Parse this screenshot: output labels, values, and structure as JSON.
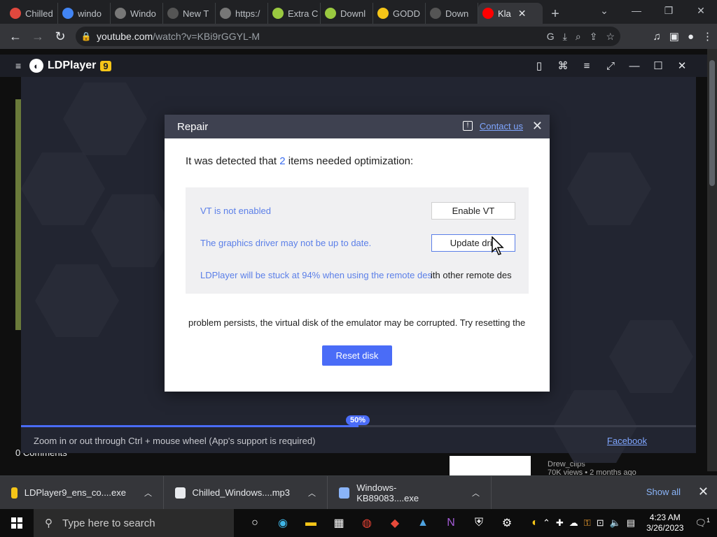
{
  "browser": {
    "tabs": [
      {
        "label": "Chilled",
        "icon": "chilled-icon",
        "color": "#e0483e"
      },
      {
        "label": "windo",
        "icon": "google-icon",
        "color": "#4285f4"
      },
      {
        "label": "Windo",
        "icon": "windows-tab-icon",
        "color": "#777"
      },
      {
        "label": "New T",
        "icon": "chrome-tab-icon",
        "color": "#555"
      },
      {
        "label": "https:/",
        "icon": "globe-icon",
        "color": "#777"
      },
      {
        "label": "Extra C",
        "icon": "android-icon",
        "color": "#9ac940"
      },
      {
        "label": "Downl",
        "icon": "android-icon",
        "color": "#9ac940"
      },
      {
        "label": "GODD",
        "icon": "ldplayer-icon",
        "color": "#f5c518"
      },
      {
        "label": "Down",
        "icon": "download-icon",
        "color": "#555"
      },
      {
        "label": "Kla",
        "icon": "youtube-icon",
        "color": "#ff0000"
      }
    ],
    "active_tab_close": "✕",
    "new_tab": "+",
    "url_host": "youtube.com",
    "url_path": "/watch?v=KBi9rGGYL-M"
  },
  "ldplayer": {
    "name": "LDPlayer",
    "version": "9",
    "progress_label": "50%",
    "progress_value": 0.5,
    "footer_hint": "Zoom in or out through Ctrl + mouse wheel (App's support is required)",
    "facebook": "Facebook"
  },
  "dialog": {
    "title": "Repair",
    "contact": "Contact us",
    "intro_prefix": "It was detected that ",
    "intro_count": "2",
    "intro_suffix": " items needed optimization:",
    "issues": [
      {
        "text": "VT is not enabled",
        "button": "Enable VT"
      },
      {
        "text": "The graphics driver may not be up to date.",
        "button": "Update driv"
      },
      {
        "text": "LDPlayer will be stuck at 94% when using the remote des",
        "tail": "ith other remote des"
      }
    ],
    "persist": "problem persists, the virtual disk of the emulator may be corrupted. Try resetting the",
    "reset": "Reset disk"
  },
  "youtube": {
    "comments": "0 Comments",
    "uploader": "Drew_clips",
    "meta": "70K views • 2 months ago"
  },
  "downloads": {
    "items": [
      {
        "name": "LDPlayer9_ens_co....exe",
        "icon": "ldplayer-icon",
        "color": "#f5c518"
      },
      {
        "name": "Chilled_Windows....mp3",
        "icon": "file-icon",
        "color": "#e8eaed"
      },
      {
        "name": "Windows-KB89083....exe",
        "icon": "installer-icon",
        "color": "#8ab4f8"
      }
    ],
    "show_all": "Show all"
  },
  "taskbar": {
    "search_placeholder": "Type here to search",
    "time": "4:23 AM",
    "date": "3/26/2023",
    "notification_count": "1"
  }
}
